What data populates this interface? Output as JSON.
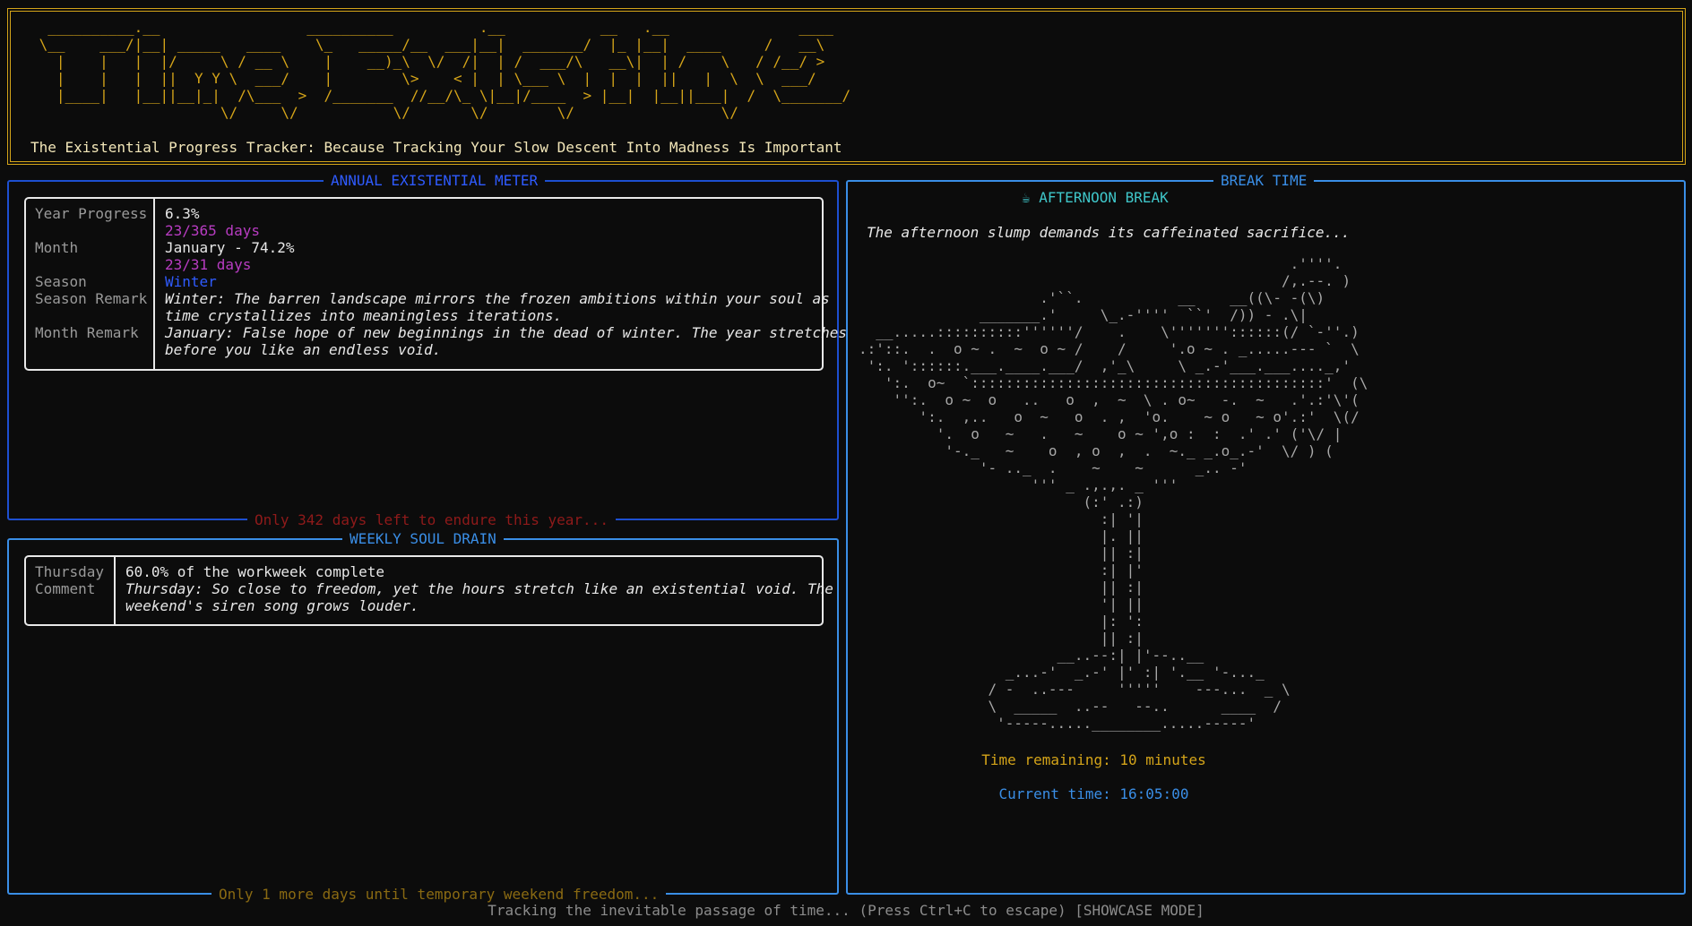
{
  "header": {
    "banner_art": "  __________.__                 __________          .__           __   .__               ____\n \\__    ___/|__| _____   ____    \\_   _____/__  ___|__|  _______/  |_ |__|  ____     /   __\\\n   |    |   |  |/     \\ / __ \\    |    __)_\\  \\/  /|  | /  ___/\\   __\\|  | /    \\   / /__/ >\n   |    |   |  ||  Y Y \\  ___/    |        \\>    < |  | \\___ \\  |  |  |  ||   |  \\  \\  ___/\n   |____|   |__||__|_|  /\\___  >  /_______  //__/\\_ \\|__|/____  > |__|  |__||___|  /  \\_______/\n                      \\/     \\/           \\/       \\/        \\/                 \\/",
    "subtitle": "The Existential Progress Tracker: Because Tracking Your Slow Descent Into Madness Is Important"
  },
  "annual": {
    "title": "ANNUAL EXISTENTIAL METER",
    "footer": "Only 342 days left to endure this year...",
    "labels": {
      "year_progress": "Year Progress",
      "month": "Month",
      "season": "Season",
      "season_remark": "Season Remark",
      "month_remark": "Month Remark"
    },
    "year_progress_value": "6.3%",
    "year_days": "23/365 days",
    "month_value": "January - 74.2%",
    "month_days": "23/31 days",
    "season_value": "Winter",
    "season_remark_line1": "Winter: The barren landscape mirrors the frozen ambitions within your soul as",
    "season_remark_line2": "time crystallizes into meaningless iterations.",
    "month_remark_line1": "January: False hope of new beginnings in the dead of winter. The year stretches",
    "month_remark_line2": "before you like an endless void."
  },
  "weekly": {
    "title": "WEEKLY SOUL DRAIN",
    "footer": "Only 1 more days until temporary weekend freedom...",
    "labels": {
      "day": "Thursday",
      "comment": "Comment"
    },
    "progress_value": "60.0% of the workweek complete",
    "comment_line1": "Thursday: So close to freedom, yet the hours stretch like an existential void. The",
    "comment_line2": "weekend's siren song grows louder."
  },
  "break": {
    "title": "BREAK TIME",
    "heading_icon": "☕",
    "heading": "AFTERNOON BREAK",
    "tagline": "The afternoon slump demands its caffeinated sacrifice...",
    "art": "                                                  .''''.\n                                                 /,.--. )\n                     .'``.           __    __((\\- -(\\)\n              _______.'     \\_.-''''  ``'  /)) - .\\|\n  __.....::::::::::''''''/    .    \\'''''''::::::(/ `-''.)\n.:'::.  .  o ~ .  ~  o ~ /    /     '.o ~ . _.....--- `  \\\n ':. '::::::.___.____.___/  ,'_\\     \\ _.-'___.___...._,'\n   ':.  o~  `:::::::::::::::::::::::::::::::::::::::::'  (\\\n    '':.  o ~  o   ..   o  ,  ~  \\ . o~   -.  ~   .'.:'\\'(\n       ':.  ,..   o  ~   o  . ,  'o.    ~ o   ~ o'.:'  \\(/\n         '.  o   ~   .   ~    o ~ ',o :  :  .' .' ('\\/ |\n          '-._   ~    o  , o  ,  .  ~._ _.o_.-'  \\/ ) (\n              '- .._  .    ~    ~      _.. -'\n                    ''' _ .,.,. _ '''\n                          (:' .:)\n                            :| '|\n                            |. ||\n                            || :|\n                            :| |'\n                            || :|\n                            '| ||\n                            |: ':\n                            || :|\n                       __..--:| |'--..__\n                 _...-'  _.-' |' :| '.__ '-..._\n               / -  ..---     '''''    ---...  _ \\\n               \\  _____  ..--   --..      ____  /\n                '-----.....________.....-----'",
    "time_remaining": "Time remaining: 10 minutes",
    "current_time": "Current time: 16:05:00"
  },
  "status_bar": "Tracking the inevitable passage of time... (Press Ctrl+C to escape) [SHOWCASE MODE]",
  "colors": {
    "gold": "#d4a419",
    "panel_blue": "#3a8ee6",
    "dark_blue": "#1d4fd0",
    "purple": "#b83cc2",
    "red_dim": "#8f1a1a",
    "olive": "#8a6a12"
  }
}
